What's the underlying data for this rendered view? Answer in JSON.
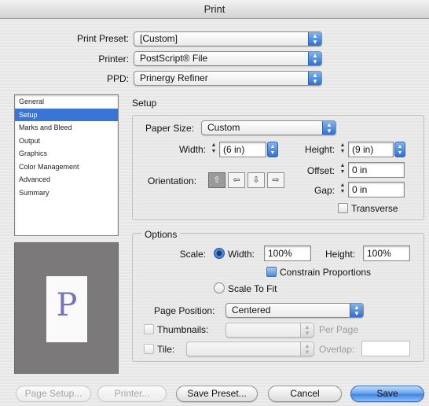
{
  "window": {
    "title": "Print"
  },
  "presets": {
    "print_preset_label": "Print Preset:",
    "print_preset_value": "[Custom]",
    "printer_label": "Printer:",
    "printer_value": "PostScript® File",
    "ppd_label": "PPD:",
    "ppd_value": "Prinergy Refiner"
  },
  "sidebar": {
    "items": [
      {
        "label": "General",
        "selected": false
      },
      {
        "label": "Setup",
        "selected": true
      },
      {
        "label": "Marks and Bleed",
        "selected": false
      },
      {
        "label": "Output",
        "selected": false
      },
      {
        "label": "Graphics",
        "selected": false
      },
      {
        "label": "Color Management",
        "selected": false
      },
      {
        "label": "Advanced",
        "selected": false
      },
      {
        "label": "Summary",
        "selected": false
      }
    ]
  },
  "preview": {
    "letter": "P"
  },
  "setup": {
    "heading": "Setup",
    "paper_size_label": "Paper Size:",
    "paper_size_value": "Custom",
    "width_label": "Width:",
    "width_value": "(6 in)",
    "height_label": "Height:",
    "height_value": "(9 in)",
    "orientation_label": "Orientation:",
    "offset_label": "Offset:",
    "offset_value": "0 in",
    "gap_label": "Gap:",
    "gap_value": "0 in",
    "transverse_label": "Transverse",
    "transverse_checked": false
  },
  "options": {
    "heading": "Options",
    "scale_label": "Scale:",
    "scale_width_label": "Width:",
    "scale_width_value": "100%",
    "scale_height_label": "Height:",
    "scale_height_value": "100%",
    "constrain_label": "Constrain Proportions",
    "constrain_checked": true,
    "scale_to_fit_label": "Scale To Fit",
    "page_position_label": "Page Position:",
    "page_position_value": "Centered",
    "thumbnails_label": "Thumbnails:",
    "per_page_label": "Per Page",
    "tile_label": "Tile:",
    "overlap_label": "Overlap:"
  },
  "buttons": {
    "page_setup": "Page Setup...",
    "printer": "Printer...",
    "save_preset": "Save Preset...",
    "cancel": "Cancel",
    "save": "Save"
  },
  "colors": {
    "selection": "#3875d7",
    "aqua_blue": "#3f84e0",
    "preview_letter": "#7275b8"
  }
}
